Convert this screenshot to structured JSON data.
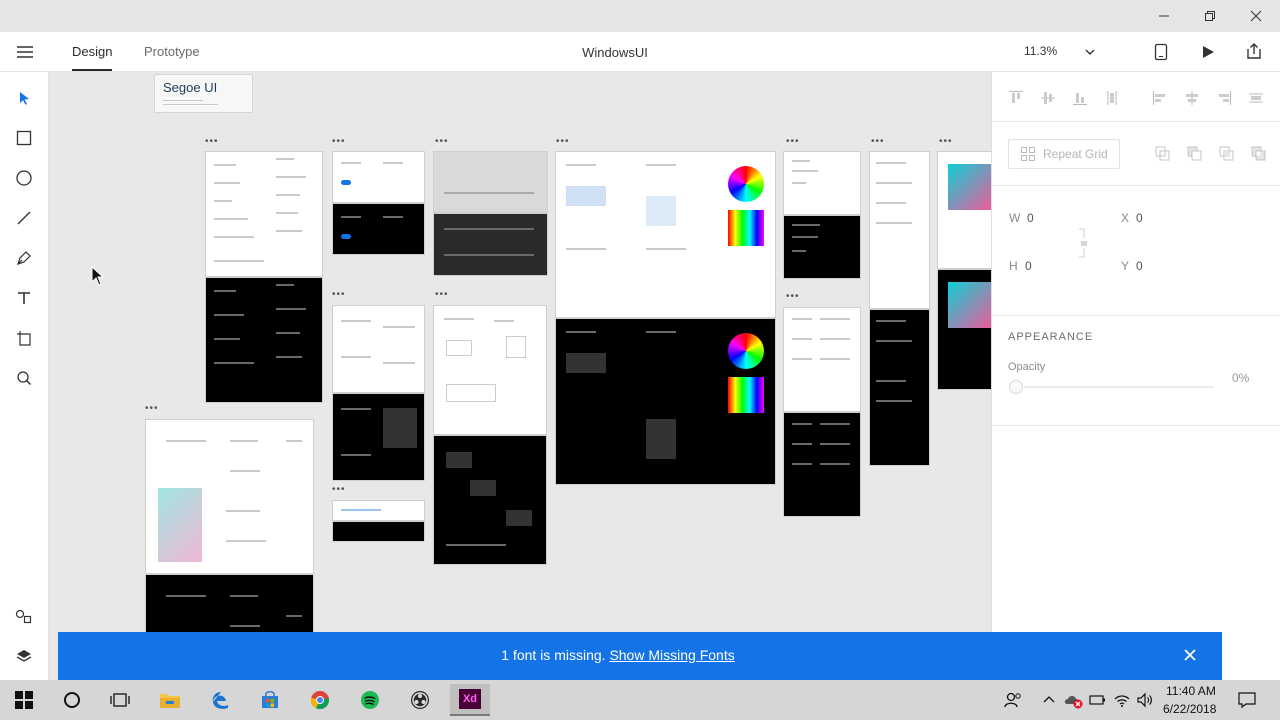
{
  "app": {
    "document_title": "WindowsUI",
    "tabs": [
      {
        "label": "Design"
      },
      {
        "label": "Prototype"
      }
    ],
    "zoom": "11.3%"
  },
  "canvas": {
    "font_card_title": "Segoe UI",
    "artboard_menu": "•••"
  },
  "inspector": {
    "repeat_grid_label": "Repeat Grid",
    "w_label": "W",
    "w_value": "0",
    "x_label": "X",
    "x_value": "0",
    "h_label": "H",
    "h_value": "0",
    "y_label": "Y",
    "y_value": "0",
    "appearance_heading": "APPEARANCE",
    "opacity_label": "Opacity",
    "opacity_value": "0%"
  },
  "banner": {
    "message": "1 font is missing.",
    "link": "Show Missing Fonts"
  },
  "taskbar": {
    "time": "11:40 AM",
    "date": "6/22/2018",
    "xd_label": "Xd"
  },
  "colors": {
    "accent": "#1473e6",
    "xd_pink": "#ff61f6",
    "xd_bg": "#470137"
  }
}
